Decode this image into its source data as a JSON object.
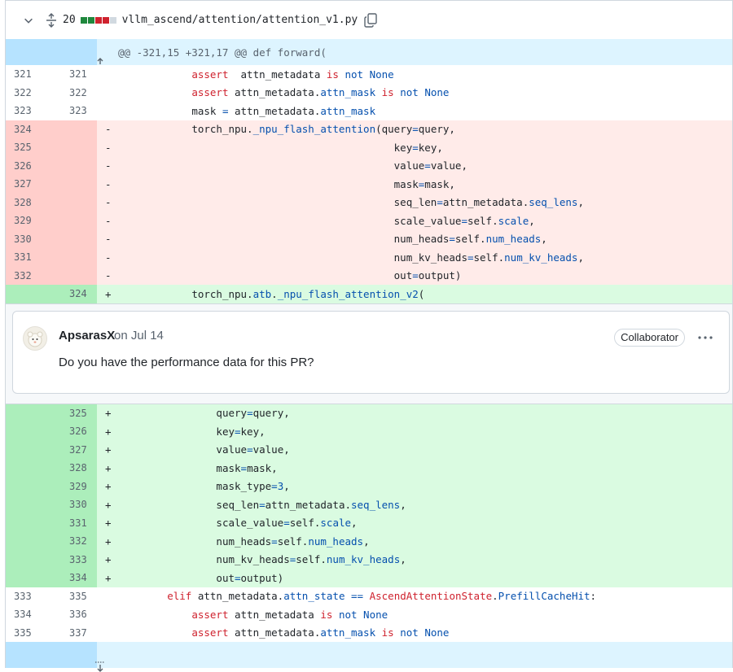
{
  "file": {
    "changes_count": "20",
    "path": "vllm_ascend/attention/attention_v1.py",
    "diffstat_colors": [
      "#1f883d",
      "#1f883d",
      "#cf222e",
      "#cf222e",
      "#d1d9e0"
    ]
  },
  "hunk": {
    "header": "@@ -321,15 +321,17 @@ def forward("
  },
  "rows_top": [
    {
      "type": "ctx",
      "old": "321",
      "new": "321",
      "sign": "",
      "indent": "            ",
      "tokens": [
        [
          "kw",
          "assert"
        ],
        [
          "",
          "  attn_metadata "
        ],
        [
          "kw",
          "is"
        ],
        [
          "",
          ""
        ],
        [
          "bl",
          " not None"
        ]
      ]
    },
    {
      "type": "ctx",
      "old": "322",
      "new": "322",
      "sign": "",
      "indent": "            ",
      "tokens": [
        [
          "kw",
          "assert"
        ],
        [
          "",
          " attn_metadata."
        ],
        [
          "fn",
          "attn_mask"
        ],
        [
          "",
          " "
        ],
        [
          "kw",
          "is"
        ],
        [
          "bl",
          " not None"
        ]
      ]
    },
    {
      "type": "ctx",
      "old": "323",
      "new": "323",
      "sign": "",
      "indent": "            ",
      "tokens": [
        [
          "",
          "mask "
        ],
        [
          "op",
          "="
        ],
        [
          "",
          " attn_metadata."
        ],
        [
          "fn",
          "attn_mask"
        ]
      ]
    },
    {
      "type": "del",
      "old": "324",
      "new": "",
      "sign": "-",
      "indent": "            ",
      "tokens": [
        [
          "",
          "torch_npu."
        ],
        [
          "fn",
          "_npu_flash_attention"
        ],
        [
          "",
          "(query"
        ],
        [
          "op",
          "="
        ],
        [
          "",
          "query,"
        ]
      ]
    },
    {
      "type": "del",
      "old": "325",
      "new": "",
      "sign": "-",
      "indent": "                                             ",
      "tokens": [
        [
          "",
          "key"
        ],
        [
          "op",
          "="
        ],
        [
          "",
          "key,"
        ]
      ]
    },
    {
      "type": "del",
      "old": "326",
      "new": "",
      "sign": "-",
      "indent": "                                             ",
      "tokens": [
        [
          "",
          "value"
        ],
        [
          "op",
          "="
        ],
        [
          "",
          "value,"
        ]
      ]
    },
    {
      "type": "del",
      "old": "327",
      "new": "",
      "sign": "-",
      "indent": "                                             ",
      "tokens": [
        [
          "",
          "mask"
        ],
        [
          "op",
          "="
        ],
        [
          "",
          "mask,"
        ]
      ]
    },
    {
      "type": "del",
      "old": "328",
      "new": "",
      "sign": "-",
      "indent": "                                             ",
      "tokens": [
        [
          "",
          "seq_len"
        ],
        [
          "op",
          "="
        ],
        [
          "",
          "attn_metadata."
        ],
        [
          "fn",
          "seq_lens"
        ],
        [
          "",
          ","
        ]
      ]
    },
    {
      "type": "del",
      "old": "329",
      "new": "",
      "sign": "-",
      "indent": "                                             ",
      "tokens": [
        [
          "",
          "scale_value"
        ],
        [
          "op",
          "="
        ],
        [
          "",
          "self."
        ],
        [
          "fn",
          "scale"
        ],
        [
          "",
          ","
        ]
      ]
    },
    {
      "type": "del",
      "old": "330",
      "new": "",
      "sign": "-",
      "indent": "                                             ",
      "tokens": [
        [
          "",
          "num_heads"
        ],
        [
          "op",
          "="
        ],
        [
          "",
          "self."
        ],
        [
          "fn",
          "num_heads"
        ],
        [
          "",
          ","
        ]
      ]
    },
    {
      "type": "del",
      "old": "331",
      "new": "",
      "sign": "-",
      "indent": "                                             ",
      "tokens": [
        [
          "",
          "num_kv_heads"
        ],
        [
          "op",
          "="
        ],
        [
          "",
          "self."
        ],
        [
          "fn",
          "num_kv_heads"
        ],
        [
          "",
          ","
        ]
      ]
    },
    {
      "type": "del",
      "old": "332",
      "new": "",
      "sign": "-",
      "indent": "                                             ",
      "tokens": [
        [
          "",
          "out"
        ],
        [
          "op",
          "="
        ],
        [
          "",
          "output)"
        ]
      ]
    },
    {
      "type": "add",
      "old": "",
      "new": "324",
      "sign": "+",
      "indent": "            ",
      "tokens": [
        [
          "",
          "torch_npu."
        ],
        [
          "fn",
          "atb"
        ],
        [
          "",
          "."
        ],
        [
          "fn",
          "_npu_flash_attention_v2"
        ],
        [
          "",
          "("
        ]
      ]
    }
  ],
  "comment": {
    "author": "ApsarasX",
    "date": "on Jul 14",
    "badge": "Collaborator",
    "body": "Do you have the performance data for this PR?"
  },
  "rows_bottom": [
    {
      "type": "add",
      "old": "",
      "new": "325",
      "sign": "+",
      "indent": "                ",
      "tokens": [
        [
          "",
          "query"
        ],
        [
          "op",
          "="
        ],
        [
          "",
          "query,"
        ]
      ]
    },
    {
      "type": "add",
      "old": "",
      "new": "326",
      "sign": "+",
      "indent": "                ",
      "tokens": [
        [
          "",
          "key"
        ],
        [
          "op",
          "="
        ],
        [
          "",
          "key,"
        ]
      ]
    },
    {
      "type": "add",
      "old": "",
      "new": "327",
      "sign": "+",
      "indent": "                ",
      "tokens": [
        [
          "",
          "value"
        ],
        [
          "op",
          "="
        ],
        [
          "",
          "value,"
        ]
      ]
    },
    {
      "type": "add",
      "old": "",
      "new": "328",
      "sign": "+",
      "indent": "                ",
      "tokens": [
        [
          "",
          "mask"
        ],
        [
          "op",
          "="
        ],
        [
          "",
          "mask,"
        ]
      ]
    },
    {
      "type": "add",
      "old": "",
      "new": "329",
      "sign": "+",
      "indent": "                ",
      "tokens": [
        [
          "",
          "mask_type"
        ],
        [
          "op",
          "="
        ],
        [
          "bl",
          "3"
        ],
        [
          "",
          ","
        ]
      ]
    },
    {
      "type": "add",
      "old": "",
      "new": "330",
      "sign": "+",
      "indent": "                ",
      "tokens": [
        [
          "",
          "seq_len"
        ],
        [
          "op",
          "="
        ],
        [
          "",
          "attn_metadata."
        ],
        [
          "fn",
          "seq_lens"
        ],
        [
          "",
          ","
        ]
      ]
    },
    {
      "type": "add",
      "old": "",
      "new": "331",
      "sign": "+",
      "indent": "                ",
      "tokens": [
        [
          "",
          "scale_value"
        ],
        [
          "op",
          "="
        ],
        [
          "",
          "self."
        ],
        [
          "fn",
          "scale"
        ],
        [
          "",
          ","
        ]
      ]
    },
    {
      "type": "add",
      "old": "",
      "new": "332",
      "sign": "+",
      "indent": "                ",
      "tokens": [
        [
          "",
          "num_heads"
        ],
        [
          "op",
          "="
        ],
        [
          "",
          "self."
        ],
        [
          "fn",
          "num_heads"
        ],
        [
          "",
          ","
        ]
      ]
    },
    {
      "type": "add",
      "old": "",
      "new": "333",
      "sign": "+",
      "indent": "                ",
      "tokens": [
        [
          "",
          "num_kv_heads"
        ],
        [
          "op",
          "="
        ],
        [
          "",
          "self."
        ],
        [
          "fn",
          "num_kv_heads"
        ],
        [
          "",
          ","
        ]
      ]
    },
    {
      "type": "add",
      "old": "",
      "new": "334",
      "sign": "+",
      "indent": "                ",
      "tokens": [
        [
          "",
          "out"
        ],
        [
          "op",
          "="
        ],
        [
          "",
          "output)"
        ]
      ]
    },
    {
      "type": "ctx",
      "old": "333",
      "new": "335",
      "sign": "",
      "indent": "        ",
      "tokens": [
        [
          "kw",
          "elif"
        ],
        [
          "",
          " attn_metadata."
        ],
        [
          "fn",
          "attn_state"
        ],
        [
          "",
          " "
        ],
        [
          "op",
          "=="
        ],
        [
          "",
          " "
        ],
        [
          "kw",
          "AscendAttentionState"
        ],
        [
          "",
          "."
        ],
        [
          "fn",
          "PrefillCacheHit"
        ],
        [
          "",
          ":"
        ]
      ]
    },
    {
      "type": "ctx",
      "old": "334",
      "new": "336",
      "sign": "",
      "indent": "            ",
      "tokens": [
        [
          "kw",
          "assert"
        ],
        [
          "",
          " attn_metadata "
        ],
        [
          "kw",
          "is"
        ],
        [
          "bl",
          " not None"
        ]
      ]
    },
    {
      "type": "ctx",
      "old": "335",
      "new": "337",
      "sign": "",
      "indent": "            ",
      "tokens": [
        [
          "kw",
          "assert"
        ],
        [
          "",
          " attn_metadata."
        ],
        [
          "fn",
          "attn_mask"
        ],
        [
          "",
          " "
        ],
        [
          "kw",
          "is"
        ],
        [
          "bl",
          " not None"
        ]
      ]
    }
  ]
}
